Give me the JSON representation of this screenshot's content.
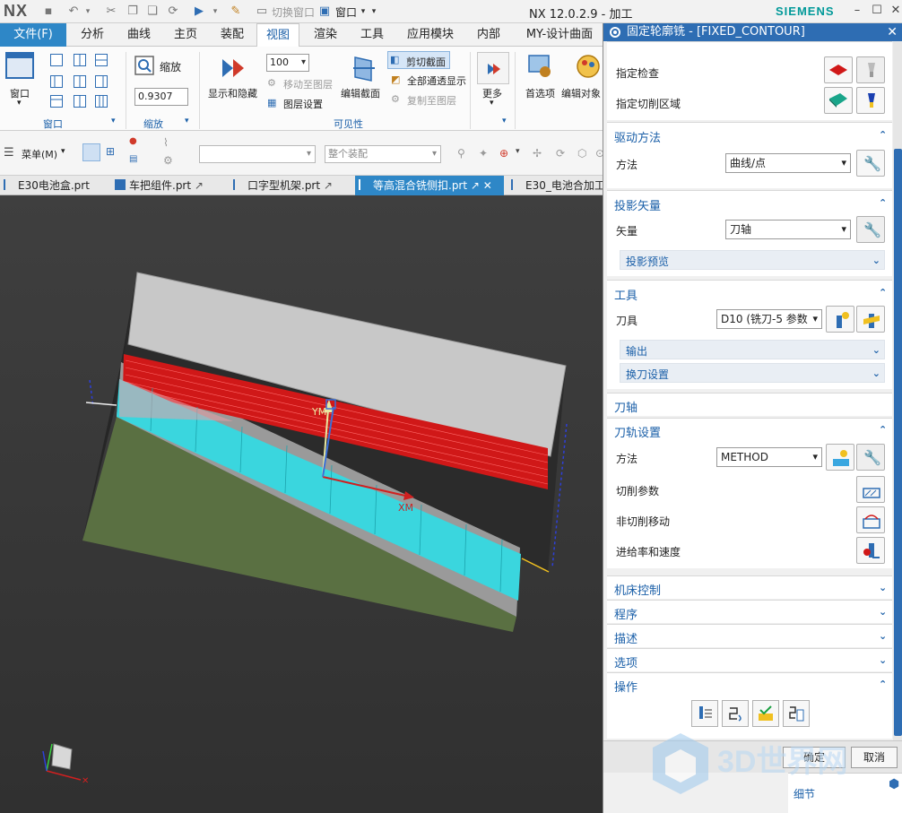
{
  "titlebar": {
    "logo": "NX",
    "switch_window": "切换窗口",
    "window_menu": "窗口",
    "app_title": "NX 12.0.2.9 - 加工",
    "brand": "SIEMENS"
  },
  "menu": {
    "file": "文件(F)",
    "tabs": [
      "分析",
      "曲线",
      "主页",
      "装配",
      "视图",
      "渲染",
      "工具",
      "应用模块",
      "内部",
      "MY-设计曲面"
    ]
  },
  "ribbon": {
    "window_label": "窗口",
    "window_group": "窗口",
    "zoom_label": "缩放",
    "zoom_value": "0.9307",
    "zoom_group": "缩放",
    "show_hide": "显示和隐藏",
    "layer_value": "100",
    "move_to_layer": "移动至图层",
    "layer_settings": "图层设置",
    "edit_section": "编辑截面",
    "clip_section": "剪切截面",
    "show_all_pass": "全部通透显示",
    "copy_to_layer": "复制至图层",
    "visibility_group": "可见性",
    "more": "更多",
    "preferences": "首选项",
    "edit_object": "编辑对象"
  },
  "toolbar2": {
    "menu_button": "菜单(M)",
    "assembly_combo": "整个装配"
  },
  "doc_tabs": [
    {
      "label": "E30电池盒.prt",
      "active": false
    },
    {
      "label": "车把组件.prt",
      "active": false
    },
    {
      "label": "口字型机架.prt",
      "active": false
    },
    {
      "label": "等高混合铣侧扣.prt",
      "active": true
    },
    {
      "label": "E30_电池合加工",
      "active": false
    }
  ],
  "viewport": {
    "ym_label": "YM",
    "xm_label": "XM"
  },
  "dialog": {
    "title": "固定轮廓铣 - [FIXED_CONTOUR]",
    "specify_check": "指定检查",
    "specify_cut_area": "指定切削区域",
    "drive_method": {
      "header": "驱动方法",
      "method_label": "方法",
      "method_value": "曲线/点"
    },
    "projection_vector": {
      "header": "投影矢量",
      "vector_label": "矢量",
      "vector_value": "刀轴",
      "preview": "投影预览"
    },
    "tool": {
      "header": "工具",
      "tool_label": "刀具",
      "tool_value": "D10 (铣刀-5 参数",
      "output": "输出",
      "tool_change": "换刀设置"
    },
    "tool_axis": {
      "header": "刀轴"
    },
    "path_settings": {
      "header": "刀轨设置",
      "method_label": "方法",
      "method_value": "METHOD",
      "cut_params": "切削参数",
      "non_cut_moves": "非切削移动",
      "feeds_speeds": "进给率和速度"
    },
    "machine_control": "机床控制",
    "program": "程序",
    "description": "描述",
    "options": "选项",
    "operations": "操作",
    "ok": "确定",
    "cancel": "取消",
    "detail": "细节"
  },
  "watermark": "3D世界网",
  "colors": {
    "accent": "#2e87c7",
    "dialog_header": "#2e6db3",
    "section_title": "#1a5fa8",
    "toolpath_red": "#d01818",
    "toolpath_cyan": "#3ad6de"
  }
}
